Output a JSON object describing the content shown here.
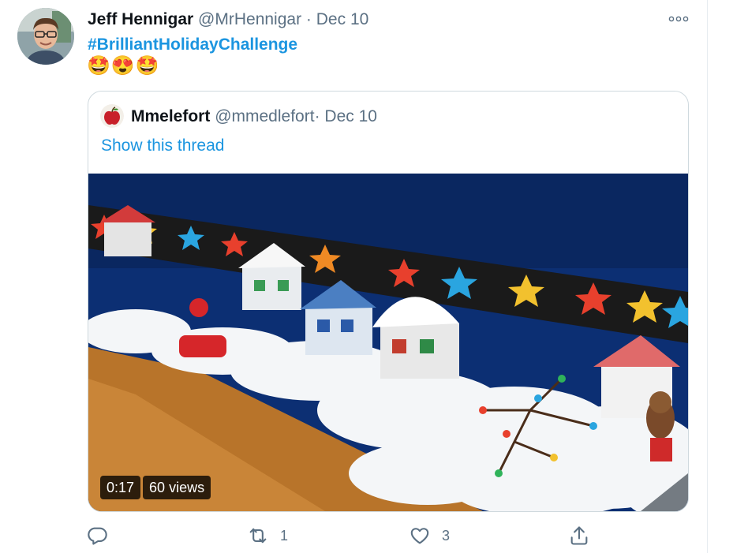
{
  "tweet": {
    "author_name": "Jeff Hennigar",
    "handle": "@MrHennigar",
    "separator": "·",
    "date": "Dec 10",
    "hashtag": "#BrilliantHolidayChallenge",
    "emojis": "🤩😍🤩",
    "more_icon": "more-horizontal-icon"
  },
  "quoted_tweet": {
    "author_name": "Mmelefort",
    "handle": "@mmedlefort",
    "separator": "·",
    "date": "Dec 10",
    "thread_link": "Show this thread",
    "video": {
      "duration": "0:17",
      "views": "60 views"
    }
  },
  "actions": {
    "reply": {
      "icon": "reply-icon",
      "count": ""
    },
    "retweet": {
      "icon": "retweet-icon",
      "count": "1"
    },
    "like": {
      "icon": "heart-icon",
      "count": "3"
    },
    "share": {
      "icon": "share-icon",
      "count": ""
    }
  },
  "colors": {
    "link": "#1b95e0",
    "muted": "#5b7083",
    "text": "#0f1419",
    "border": "#cfd9de"
  }
}
